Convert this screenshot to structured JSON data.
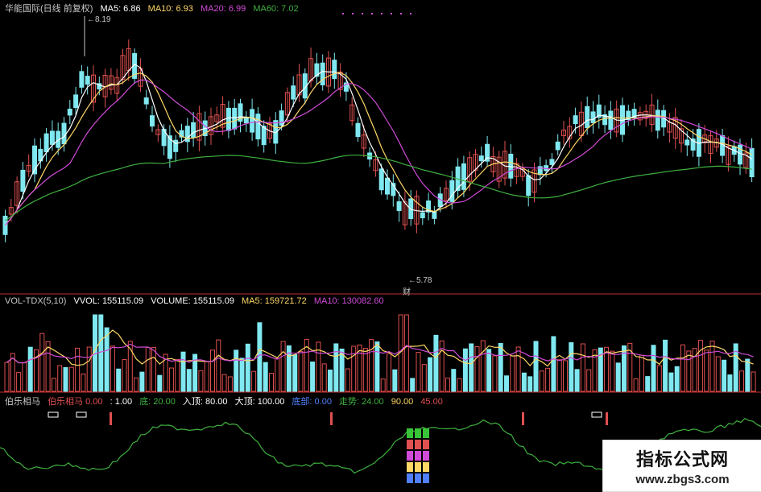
{
  "colors": {
    "bg": "#000000",
    "up": "#e05050",
    "down": "#7fe8f0",
    "ma5": "#ffffff",
    "ma10": "#ffd866",
    "ma20": "#d14bd8",
    "ma60": "#3fb13f",
    "sep": "#c03030",
    "label": "#c8c8c8",
    "green": "#39c339",
    "blue": "#5080ff",
    "magenta": "#d14bd8"
  },
  "price_panel": {
    "title": "华能国际(日线 前复权)",
    "ma_labels": [
      {
        "text": "MA5: 6.86",
        "color": "#ffffff"
      },
      {
        "text": "MA10: 6.93",
        "color": "#ffd866"
      },
      {
        "text": "MA20: 6.99",
        "color": "#d14bd8"
      },
      {
        "text": "MA60: 7.02",
        "color": "#3fb13f"
      }
    ],
    "high_note": "8.19",
    "low_note": "5.78",
    "event_mark": "财"
  },
  "volume_panel": {
    "labels": [
      {
        "text": "VOL-TDX(5,10)",
        "color": "#c8c8c8"
      },
      {
        "text": "VVOL: 155115.09",
        "color": "#ffffff"
      },
      {
        "text": "VOLUME: 155115.09",
        "color": "#ffffff"
      },
      {
        "text": "MA5: 159721.72",
        "color": "#ffd866"
      },
      {
        "text": "MA10: 130082.60",
        "color": "#d14bd8"
      }
    ]
  },
  "indicator_panel": {
    "labels": [
      {
        "text": "伯乐相马",
        "color": "#c8c8c8"
      },
      {
        "text": "伯乐相马 0.00",
        "color": "#e05050"
      },
      {
        "text": ": 1.00",
        "color": "#ffffff"
      },
      {
        "text": "底: 20.00",
        "color": "#3fb13f"
      },
      {
        "text": "入顶: 80.00",
        "color": "#ffffff"
      },
      {
        "text": "大顶: 100.00",
        "color": "#ffffff"
      },
      {
        "text": "底部: 0.00",
        "color": "#5080ff"
      },
      {
        "text": "走势: 24.00",
        "color": "#3fb13f"
      },
      {
        "text": "90.00",
        "color": "#ffd866"
      },
      {
        "text": "45.00",
        "color": "#e05050"
      }
    ]
  },
  "watermark": {
    "title": "指标公式网",
    "url": "www.zbgs3.com"
  }
}
